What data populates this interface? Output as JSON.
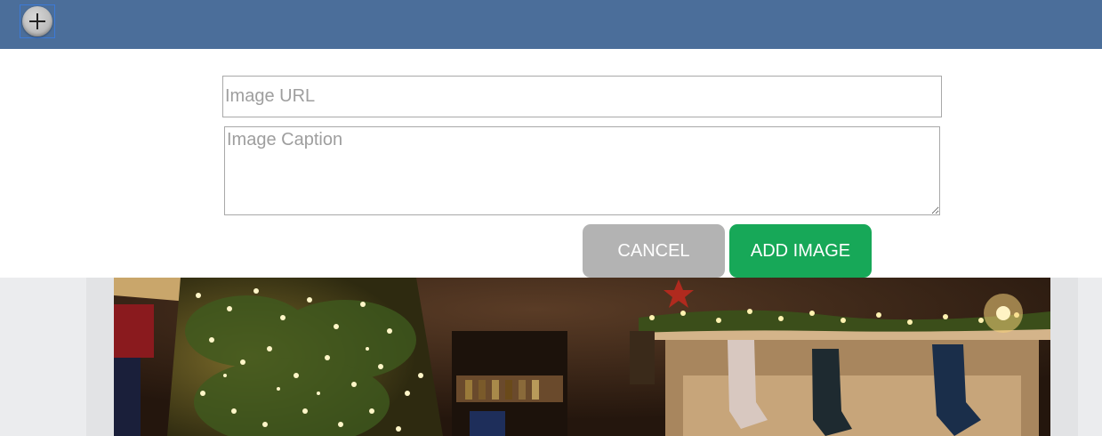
{
  "toolbar": {
    "add_button_icon": "plus-icon"
  },
  "form": {
    "url_placeholder": "Image URL",
    "caption_placeholder": "Image Caption",
    "cancel_label": "CANCEL",
    "add_label": "ADD IMAGE"
  },
  "colors": {
    "topbar": "#4b6e9a",
    "cancel": "#b3b3b3",
    "add": "#17a858"
  },
  "content": {
    "photo_subject": "christmas-scene-image"
  }
}
